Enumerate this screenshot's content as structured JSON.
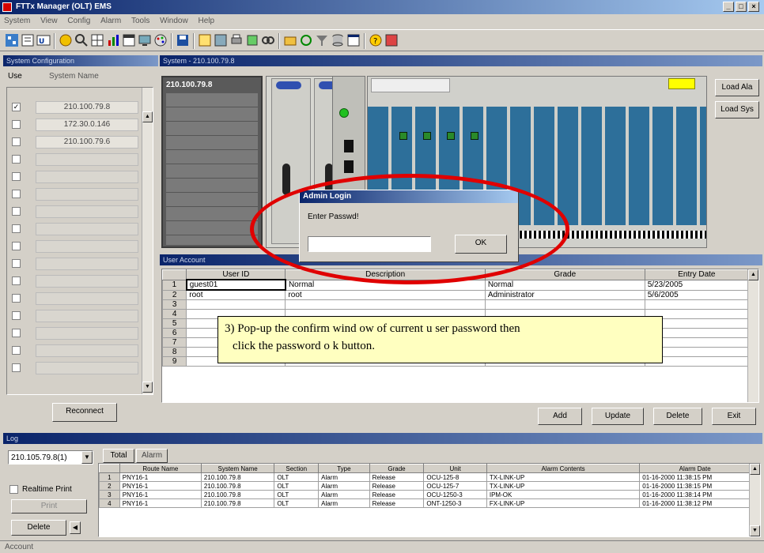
{
  "window": {
    "title": "FTTx Manager (OLT) EMS",
    "controls": [
      "_",
      "□",
      "×"
    ]
  },
  "menu": [
    "System",
    "View",
    "Config",
    "Alarm",
    "Tools",
    "Window",
    "Help"
  ],
  "system_panel": {
    "header": "System Configuration",
    "col_use": "Use",
    "col_name": "System Name",
    "systems": [
      {
        "name": "210.100.79.8",
        "checked": true
      },
      {
        "name": "172.30.0.146",
        "checked": false
      },
      {
        "name": "210.100.79.6",
        "checked": false
      }
    ],
    "reconnect_label": "Reconnect"
  },
  "rack_panel": {
    "header": "System - 210.100.79.8",
    "rack_ip": "210.100.79.8",
    "load_alarm": "Load Ala",
    "load_sys": "Load Sys"
  },
  "dialog": {
    "title": "Admin Login",
    "prompt": "Enter Passwd!",
    "password_value": "",
    "ok_label": "OK"
  },
  "user_panel": {
    "header": "User Account",
    "columns": [
      "",
      "User ID",
      "Description",
      "Grade",
      "Entry Date"
    ],
    "rows": [
      {
        "num": "1",
        "id": "guest01",
        "desc": "Normal",
        "grade": "Normal",
        "date": "5/23/2005"
      },
      {
        "num": "2",
        "id": "root",
        "desc": "root",
        "grade": "Administrator",
        "date": "5/6/2005"
      },
      {
        "num": "3",
        "id": "",
        "desc": "",
        "grade": "",
        "date": ""
      },
      {
        "num": "4",
        "id": "",
        "desc": "",
        "grade": "",
        "date": ""
      },
      {
        "num": "5",
        "id": "",
        "desc": "",
        "grade": "",
        "date": ""
      },
      {
        "num": "6",
        "id": "",
        "desc": "",
        "grade": "",
        "date": ""
      },
      {
        "num": "7",
        "id": "",
        "desc": "",
        "grade": "",
        "date": ""
      },
      {
        "num": "8",
        "id": "",
        "desc": "",
        "grade": "",
        "date": ""
      },
      {
        "num": "9",
        "id": "",
        "desc": "",
        "grade": "",
        "date": ""
      }
    ],
    "buttons": {
      "add": "Add",
      "update": "Update",
      "delete": "Delete",
      "exit": "Exit"
    }
  },
  "annotation": {
    "line1": "3) Pop-up the confirm wind ow of current u ser password then",
    "line2": "click the password o k button."
  },
  "log_panel": {
    "header": "Log",
    "system_select": "210.105.79.8(1)",
    "tabs": [
      "Total",
      "Alarm"
    ],
    "realtime_label": "Realtime Print",
    "print_label": "Print",
    "delete_label": "Delete",
    "columns": [
      "",
      "Route Name",
      "System Name",
      "Section",
      "Type",
      "Grade",
      "Unit",
      "Alarm Contents",
      "Alarm Date"
    ],
    "rows": [
      {
        "num": "1",
        "route": "PNY16-1",
        "system": "210.100.79.8",
        "section": "OLT",
        "type": "Alarm",
        "grade": "Release",
        "unit": "OCU-125-8",
        "contents": "TX-LINK-UP",
        "date": "01-16-2000 11:38:15 PM"
      },
      {
        "num": "2",
        "route": "PNY16-1",
        "system": "210.100.79.8",
        "section": "OLT",
        "type": "Alarm",
        "grade": "Release",
        "unit": "OCU-125-7",
        "contents": "TX-LINK-UP",
        "date": "01-16-2000 11:38:15 PM"
      },
      {
        "num": "3",
        "route": "PNY16-1",
        "system": "210.100.79.8",
        "section": "OLT",
        "type": "Alarm",
        "grade": "Release",
        "unit": "OCU-1250-3",
        "contents": "IPM-OK",
        "date": "01-16-2000 11:38:14 PM"
      },
      {
        "num": "4",
        "route": "PNY16-1",
        "system": "210.100.79.8",
        "section": "OLT",
        "type": "Alarm",
        "grade": "Release",
        "unit": "ONT-1250-3",
        "contents": "FX-LINK-UP",
        "date": "01-16-2000 11:38:12 PM"
      }
    ]
  },
  "statusbar": {
    "text": "Account"
  },
  "colors": {
    "accent": "#0a246a",
    "highlight": "#e00000",
    "note_bg": "#ffffc0"
  }
}
